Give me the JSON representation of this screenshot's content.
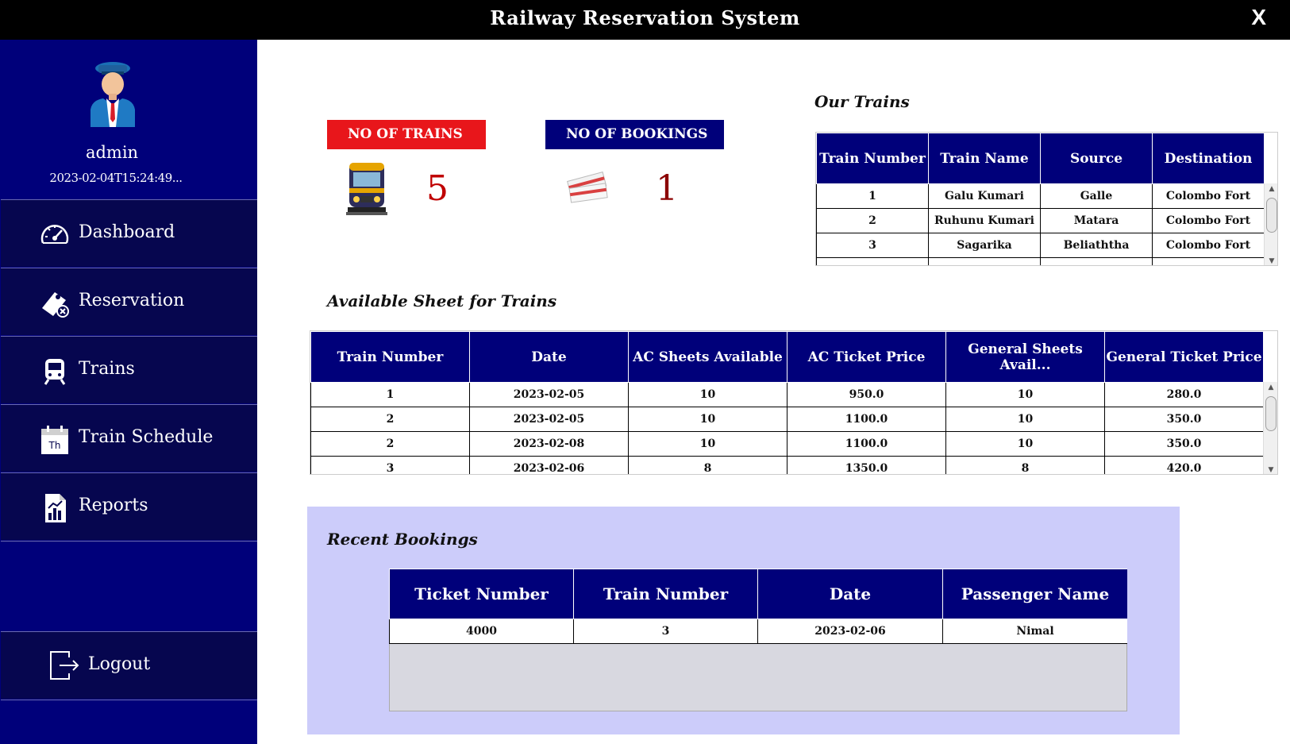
{
  "window": {
    "title": "Railway Reservation System",
    "close_label": "X"
  },
  "profile": {
    "username": "admin",
    "timestamp": "2023-02-04T15:24:49..."
  },
  "nav": {
    "items": [
      {
        "label": "Dashboard",
        "icon": "speedometer-icon"
      },
      {
        "label": "Reservation",
        "icon": "ticket-icon"
      },
      {
        "label": "Trains",
        "icon": "train-icon"
      },
      {
        "label": "Train Schedule",
        "icon": "calendar-icon"
      },
      {
        "label": "Reports",
        "icon": "report-icon"
      }
    ],
    "logout_label": "Logout"
  },
  "stats": {
    "trains": {
      "label": "NO OF TRAINS",
      "value": "5",
      "color": "#e8161b"
    },
    "bookings": {
      "label": "NO OF BOOKINGS",
      "value": "1",
      "color": "#00007a"
    }
  },
  "our_trains": {
    "title": "Our Trains",
    "columns": [
      "Train Number",
      "Train Name",
      "Source",
      "Destination"
    ],
    "rows": [
      [
        "1",
        "Galu Kumari",
        "Galle",
        "Colombo Fort"
      ],
      [
        "2",
        "Ruhunu Kumari",
        "Matara",
        "Colombo Fort"
      ],
      [
        "3",
        "Sagarika",
        "Beliaththa",
        "Colombo Fort"
      ]
    ]
  },
  "available": {
    "title": "Available Sheet for Trains",
    "columns": [
      "Train Number",
      "Date",
      "AC Sheets Available",
      "AC Ticket Price",
      "General Sheets Avail...",
      "General Ticket Price"
    ],
    "rows": [
      [
        "1",
        "2023-02-05",
        "10",
        "950.0",
        "10",
        "280.0"
      ],
      [
        "2",
        "2023-02-05",
        "10",
        "1100.0",
        "10",
        "350.0"
      ],
      [
        "2",
        "2023-02-08",
        "10",
        "1100.0",
        "10",
        "350.0"
      ],
      [
        "3",
        "2023-02-06",
        "8",
        "1350.0",
        "8",
        "420.0"
      ]
    ]
  },
  "recent": {
    "title": "Recent Bookings",
    "columns": [
      "Ticket Number",
      "Train Number",
      "Date",
      "Passenger Name"
    ],
    "rows": [
      [
        "4000",
        "3",
        "2023-02-06",
        "Nimal"
      ]
    ]
  },
  "colors": {
    "navy": "#00007a",
    "dark_navy": "#06064f",
    "panel": "#ccccfa",
    "accent_red": "#e8161b",
    "value_red": "#c00000"
  }
}
